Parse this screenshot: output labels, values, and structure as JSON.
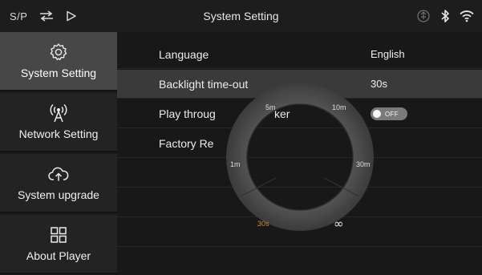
{
  "topbar": {
    "sp_label": "S/P",
    "title": "System Setting",
    "left_icons": [
      "swap-arrows-icon",
      "play-icon"
    ],
    "right_icons": [
      "usb-icon",
      "bluetooth-icon",
      "wifi-icon"
    ]
  },
  "sidebar": {
    "items": [
      {
        "label": "System Setting",
        "icon": "gear-icon",
        "active": true
      },
      {
        "label": "Network Setting",
        "icon": "antenna-icon",
        "active": false
      },
      {
        "label": "System upgrade",
        "icon": "cloud-upload-icon",
        "active": false
      },
      {
        "label": "About Player",
        "icon": "grid-icon",
        "active": false
      }
    ]
  },
  "settings": {
    "rows": [
      {
        "name": "Language",
        "value": "English"
      },
      {
        "name": "Backlight time-out",
        "value": "30s",
        "selected": true
      },
      {
        "name": "Play through speaker",
        "visible_name": "Play throug",
        "visible_name_tail": "ker",
        "toggle": "OFF"
      },
      {
        "name": "Factory Reset",
        "visible_name": "Factory Re"
      }
    ]
  },
  "ring_selector": {
    "options": [
      "5m",
      "10m",
      "1m",
      "30m",
      "30s",
      "∞"
    ],
    "selected": "30s",
    "colors": {
      "ring": "#4d4d4d",
      "selected": "#d98a24",
      "text": "#dcdcdc"
    }
  }
}
